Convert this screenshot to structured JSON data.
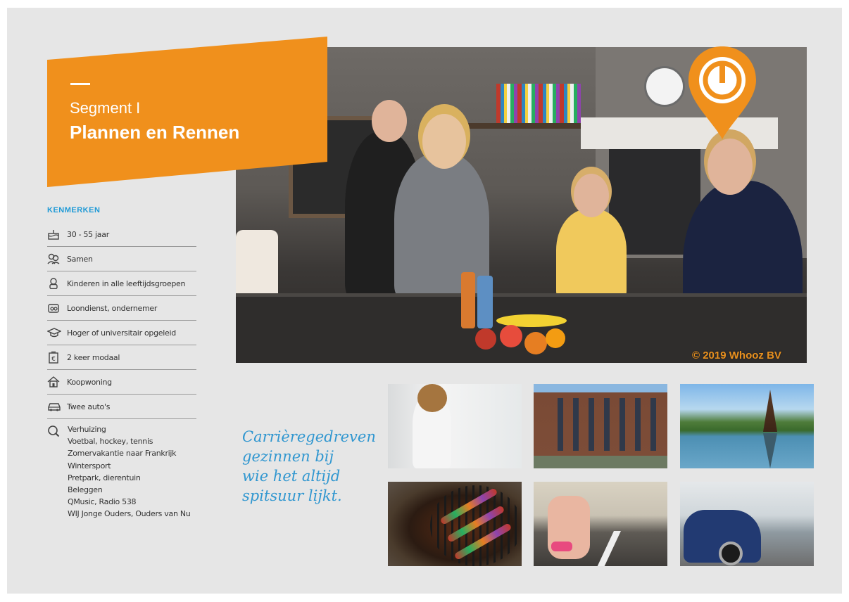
{
  "banner": {
    "segment_label": "Segment I",
    "segment_name": "Plannen en Rennen",
    "color": "#f0901c"
  },
  "hero": {
    "copyright": "© 2019 Whooz BV",
    "pin_icon": "power-pin-icon"
  },
  "kenmerken": {
    "title": "KENMERKEN",
    "items": [
      {
        "icon": "cake-icon",
        "label": "30 - 55 jaar"
      },
      {
        "icon": "couple-icon",
        "label": "Samen"
      },
      {
        "icon": "child-icon",
        "label": "Kinderen in alle leeftijdsgroepen"
      },
      {
        "icon": "wallet-icon",
        "label": "Loondienst, ondernemer"
      },
      {
        "icon": "graduation-cap-icon",
        "label": "Hoger of universitair opgeleid"
      },
      {
        "icon": "money-bag-icon",
        "label": "2 keer modaal"
      },
      {
        "icon": "house-icon",
        "label": "Koopwoning"
      },
      {
        "icon": "car-icon",
        "label": "Twee auto's"
      }
    ],
    "interests_icon": "magnifier-icon",
    "interests": [
      "Verhuizing",
      "Voetbal, hockey, tennis",
      "Zomervakantie naar Frankrijk",
      "Wintersport",
      "Pretpark, dierentuin",
      "Beleggen",
      "QMusic, Radio 538",
      "WIJ Jonge Ouders, Ouders van Nu"
    ]
  },
  "slogan": {
    "lines": [
      "Carrièregedreven",
      "gezinnen bij",
      "wie het altijd",
      "spitsuur lijkt."
    ],
    "color": "#3197d0"
  },
  "accent_blue": "#1f9ad6"
}
